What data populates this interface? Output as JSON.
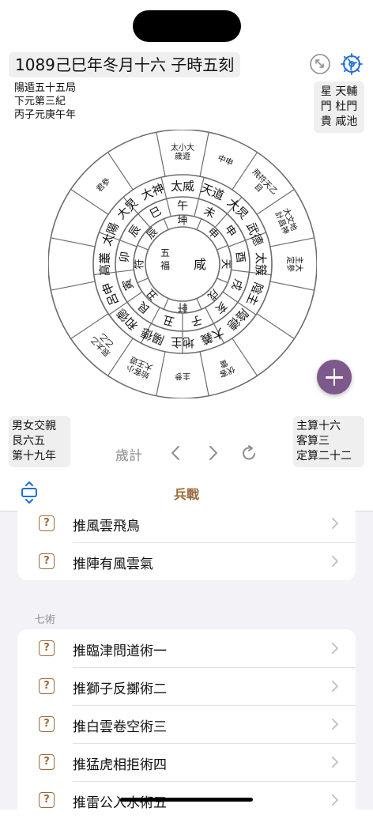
{
  "header": {
    "title": "1089己巳年冬月十六 子時五刻"
  },
  "info_top_left": [
    "陽遁五十五局",
    "下元第三紀",
    "丙子元庚午年"
  ],
  "info_top_right": [
    "星 天輔",
    "門 杜門",
    "貴 咸池"
  ],
  "info_bottom_left": [
    "男女交親",
    "艮六五",
    "第十九年"
  ],
  "info_bottom_right": [
    "主算十六",
    "客算三",
    "定算二十二"
  ],
  "wheel": {
    "center": [
      "五福",
      "咸"
    ],
    "inner": [
      "坤",
      "申",
      "天",
      "戌",
      "軒",
      "丑",
      "符",
      "辰"
    ],
    "ring2": [
      "午",
      "未",
      "申",
      "酉",
      "戌",
      "亥",
      "子",
      "丑",
      "艮",
      "寅",
      "卯",
      "辰",
      "巳"
    ],
    "ring3": [
      "太威",
      "天道",
      "大炅",
      "武德",
      "太簇",
      "陰主",
      "陰德",
      "大義",
      "地主",
      "陽德",
      "和德",
      "呂申",
      "高叢",
      "太陽",
      "大炅",
      "大神"
    ],
    "outer": [
      "太小大\n歲遊",
      "中申",
      "飛符天乙\n目",
      "大文地\n計昌神",
      "主大\n定參",
      "",
      "",
      "伏客\n雷",
      "主參",
      "始客小\n大王遊",
      "辰太乙\n乙乙",
      "",
      "",
      "",
      "君參",
      ""
    ]
  },
  "controls": {
    "label": "歲計"
  },
  "tabbar": {
    "title": "兵戰"
  },
  "group1": [
    "推風雲飛鳥",
    "推陣有風雲氣"
  ],
  "section_label": "七術",
  "group2": [
    "推臨津問道術一",
    "推獅子反擲術二",
    "推白雲卷空術三",
    "推猛虎相拒術四",
    "推雷公入水術五"
  ],
  "icons": {
    "row_icon": "?",
    "accent": "#9a6a3c",
    "fab": "#7e5a8c"
  }
}
